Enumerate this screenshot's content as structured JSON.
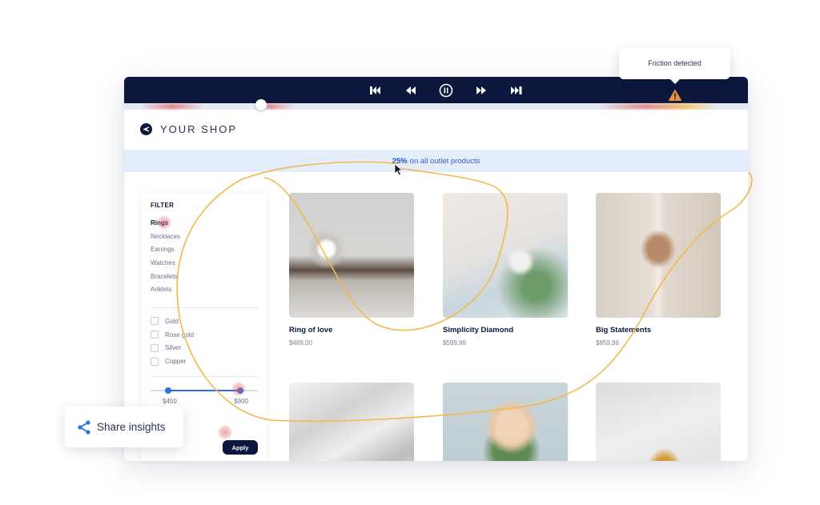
{
  "player": {
    "controls": [
      {
        "name": "skip-to-start",
        "icon": "skip-back-icon"
      },
      {
        "name": "rewind",
        "icon": "rewind-icon"
      },
      {
        "name": "pause",
        "icon": "pause-circle-icon"
      },
      {
        "name": "fast-forward",
        "icon": "fast-forward-icon"
      },
      {
        "name": "skip-to-end",
        "icon": "skip-forward-icon"
      }
    ],
    "friction_tooltip": "Friction detected",
    "warning_icon": "warning-triangle-icon",
    "colors": {
      "bar": "#0b173d",
      "warning": "#e8903a",
      "heat_red": "#e25a5a",
      "heat_yellow": "#f5c14a"
    }
  },
  "shop": {
    "title": "YOUR SHOP",
    "promo": {
      "highlight": "25%",
      "text": "on all outlet products"
    }
  },
  "filter": {
    "title": "FILTER",
    "categories": [
      {
        "label": "Rings",
        "active": true
      },
      {
        "label": "Necklaces",
        "active": false
      },
      {
        "label": "Earrings",
        "active": false
      },
      {
        "label": "Watches",
        "active": false
      },
      {
        "label": "Bracelets",
        "active": false
      },
      {
        "label": "Anklets",
        "active": false
      }
    ],
    "materials": [
      {
        "label": "Gold",
        "checked": false
      },
      {
        "label": "Rose gold",
        "checked": false
      },
      {
        "label": "Silver",
        "checked": false
      },
      {
        "label": "Copper",
        "checked": false
      }
    ],
    "price_range": {
      "min_label": "$450",
      "max_label": "$900"
    },
    "apply_label": "Apply"
  },
  "products": [
    {
      "name": "Ring of love",
      "price": "$489,00",
      "image": "diamond-ring-photo"
    },
    {
      "name": "Simplicity Diamond",
      "price": "$599,99",
      "image": "ring-with-flowers-photo"
    },
    {
      "name": "Big Statements",
      "price": "$859,99",
      "image": "hands-with-rings-photo"
    },
    {
      "name": "",
      "price": "",
      "image": "ring-on-fabric-photo"
    },
    {
      "name": "",
      "price": "",
      "image": "bouquet-photo"
    },
    {
      "name": "",
      "price": "",
      "image": "rings-on-book-photo"
    }
  ],
  "share": {
    "label": "Share insights",
    "icon": "share-icon",
    "color": "#2f6fe0"
  }
}
